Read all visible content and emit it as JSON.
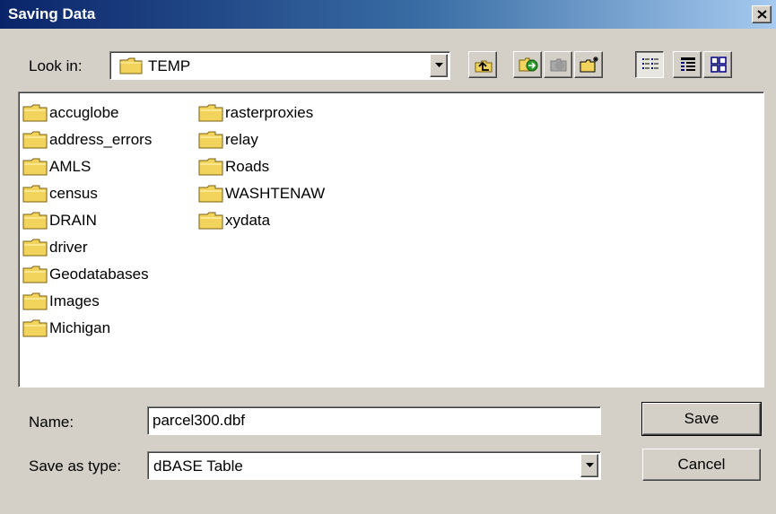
{
  "window": {
    "title": "Saving Data"
  },
  "look_in": {
    "label": "Look in:",
    "value": "TEMP"
  },
  "toolbar": {
    "icons": [
      "up-one-level-icon",
      "connect-to-folder-icon",
      "disconnect-folder-icon",
      "new-folder-icon",
      "list-view-icon",
      "details-view-icon",
      "thumbnails-view-icon"
    ]
  },
  "files": {
    "column1": [
      "accuglobe",
      "address_errors",
      "AMLS",
      "census",
      "DRAIN",
      "driver",
      "Geodatabases",
      "Images",
      "Michigan"
    ],
    "column2": [
      "rasterproxies",
      "relay",
      "Roads",
      "WASHTENAW",
      "xydata"
    ]
  },
  "name_field": {
    "label": "Name:",
    "value": "parcel300.dbf"
  },
  "type_field": {
    "label": "Save as type:",
    "value": "dBASE Table"
  },
  "buttons": {
    "save": "Save",
    "cancel": "Cancel"
  },
  "colors": {
    "titlebar_start": "#0a246a",
    "titlebar_end": "#a6caf0",
    "face": "#d4d0c8",
    "folder": "#f2d35c"
  }
}
